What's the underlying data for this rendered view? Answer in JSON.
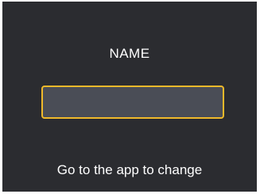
{
  "screen": {
    "title": "NAME",
    "name_field": {
      "value": "",
      "placeholder": ""
    },
    "hint": "Go to the app to change"
  },
  "colors": {
    "background": "#2b2c30",
    "field_fill": "#4a4d56",
    "field_border": "#f0b92a",
    "text": "#ffffff"
  }
}
